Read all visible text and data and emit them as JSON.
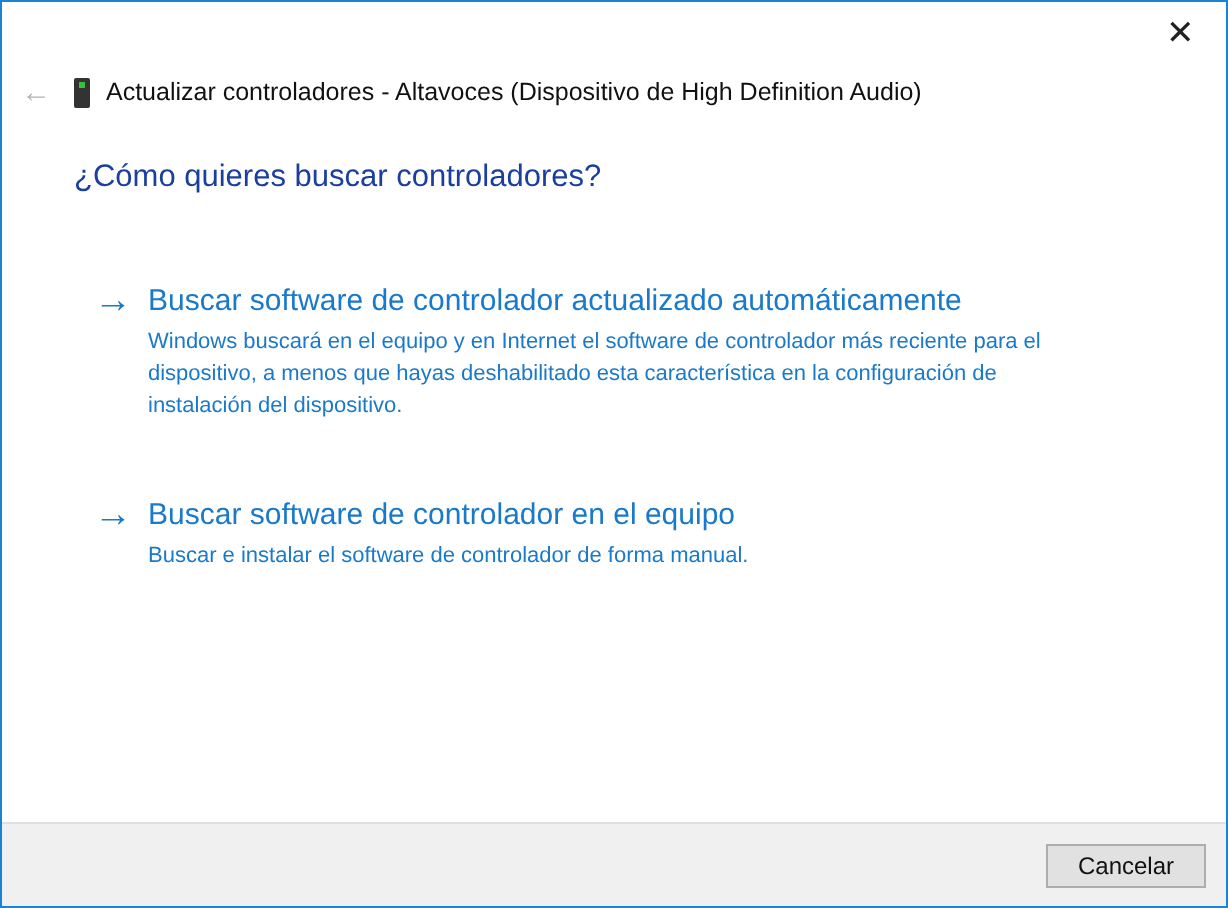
{
  "window": {
    "close": "✕",
    "back": "←",
    "back_disabled": true,
    "title": "Actualizar controladores - Altavoces (Dispositivo de High Definition Audio)"
  },
  "heading": "¿Cómo quieres buscar controladores?",
  "options": [
    {
      "arrow": "→",
      "title": "Buscar software de controlador actualizado automáticamente",
      "description": "Windows buscará en el equipo y en Internet el software de controlador más reciente para el dispositivo, a menos que hayas deshabilitado esta característica en la configuración de instalación del dispositivo."
    },
    {
      "arrow": "→",
      "title": "Buscar software de controlador en el equipo",
      "description": "Buscar e instalar el software de controlador de forma manual."
    }
  ],
  "buttons": [
    "Cancelar"
  ]
}
